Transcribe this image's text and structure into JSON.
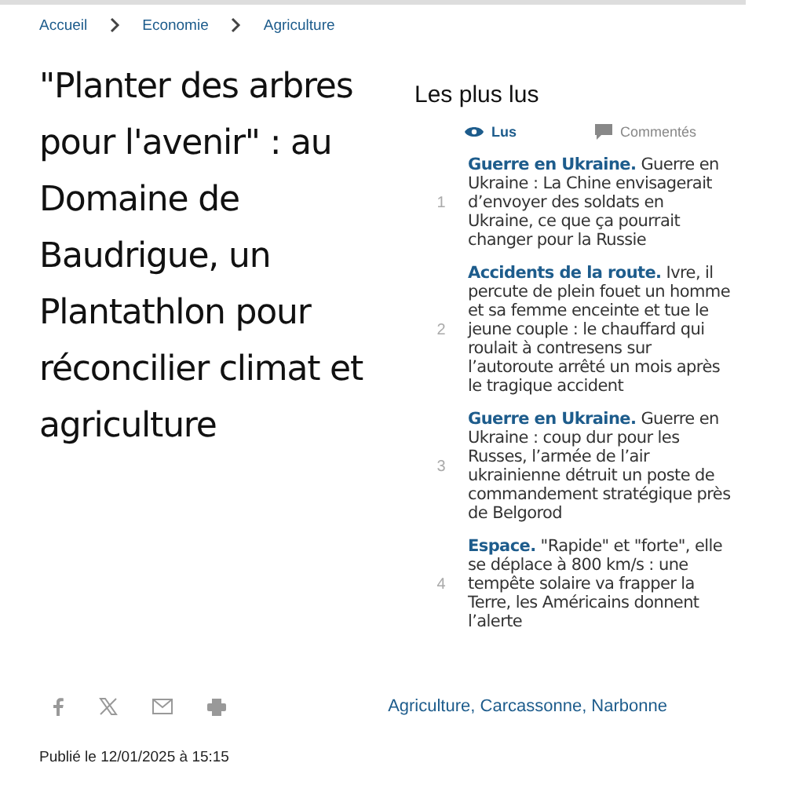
{
  "breadcrumb": [
    {
      "label": "Accueil"
    },
    {
      "label": "Economie"
    },
    {
      "label": "Agriculture"
    }
  ],
  "article": {
    "title": "\"Planter des arbres pour l'avenir\" : au Domaine de Baudrigue, un Plantathlon pour réconcilier climat et agriculture",
    "published": "Publié le 12/01/2025 à 15:15",
    "tags": "Agriculture, Carcassonne, Narbonne"
  },
  "share": [
    {
      "kind": "facebook"
    },
    {
      "kind": "x"
    },
    {
      "kind": "mail"
    },
    {
      "kind": "print"
    }
  ],
  "most_read": {
    "title": "Les plus lus",
    "tabs": [
      {
        "label": "Lus",
        "kind": "eye",
        "selected": true
      },
      {
        "label": "Commentés",
        "kind": "comment",
        "selected": false
      }
    ],
    "items": [
      {
        "rank": "1",
        "category": "Guerre en Ukraine.",
        "text": "Guerre en Ukraine : La Chine envisagerait d’envoyer des soldats en Ukraine, ce que ça pourrait changer pour la Russie"
      },
      {
        "rank": "2",
        "category": "Accidents de la route.",
        "text": "Ivre, il percute de plein fouet un homme et sa femme enceinte et tue le jeune couple : le chauffard qui roulait à contresens sur l’autoroute arrêté un mois après le tragique accident"
      },
      {
        "rank": "3",
        "category": "Guerre en Ukraine.",
        "text": "Guerre en Ukraine : coup dur pour les Russes, l’armée de l’air ukrainienne détruit un poste de commandement stratégique près de Belgorod"
      },
      {
        "rank": "4",
        "category": "Espace.",
        "text": "\"Rapide\" et \"forte\", elle se déplace à 800 km/s : une tempête solaire va frapper la Terre, les Américains donnent l’alerte"
      }
    ]
  }
}
